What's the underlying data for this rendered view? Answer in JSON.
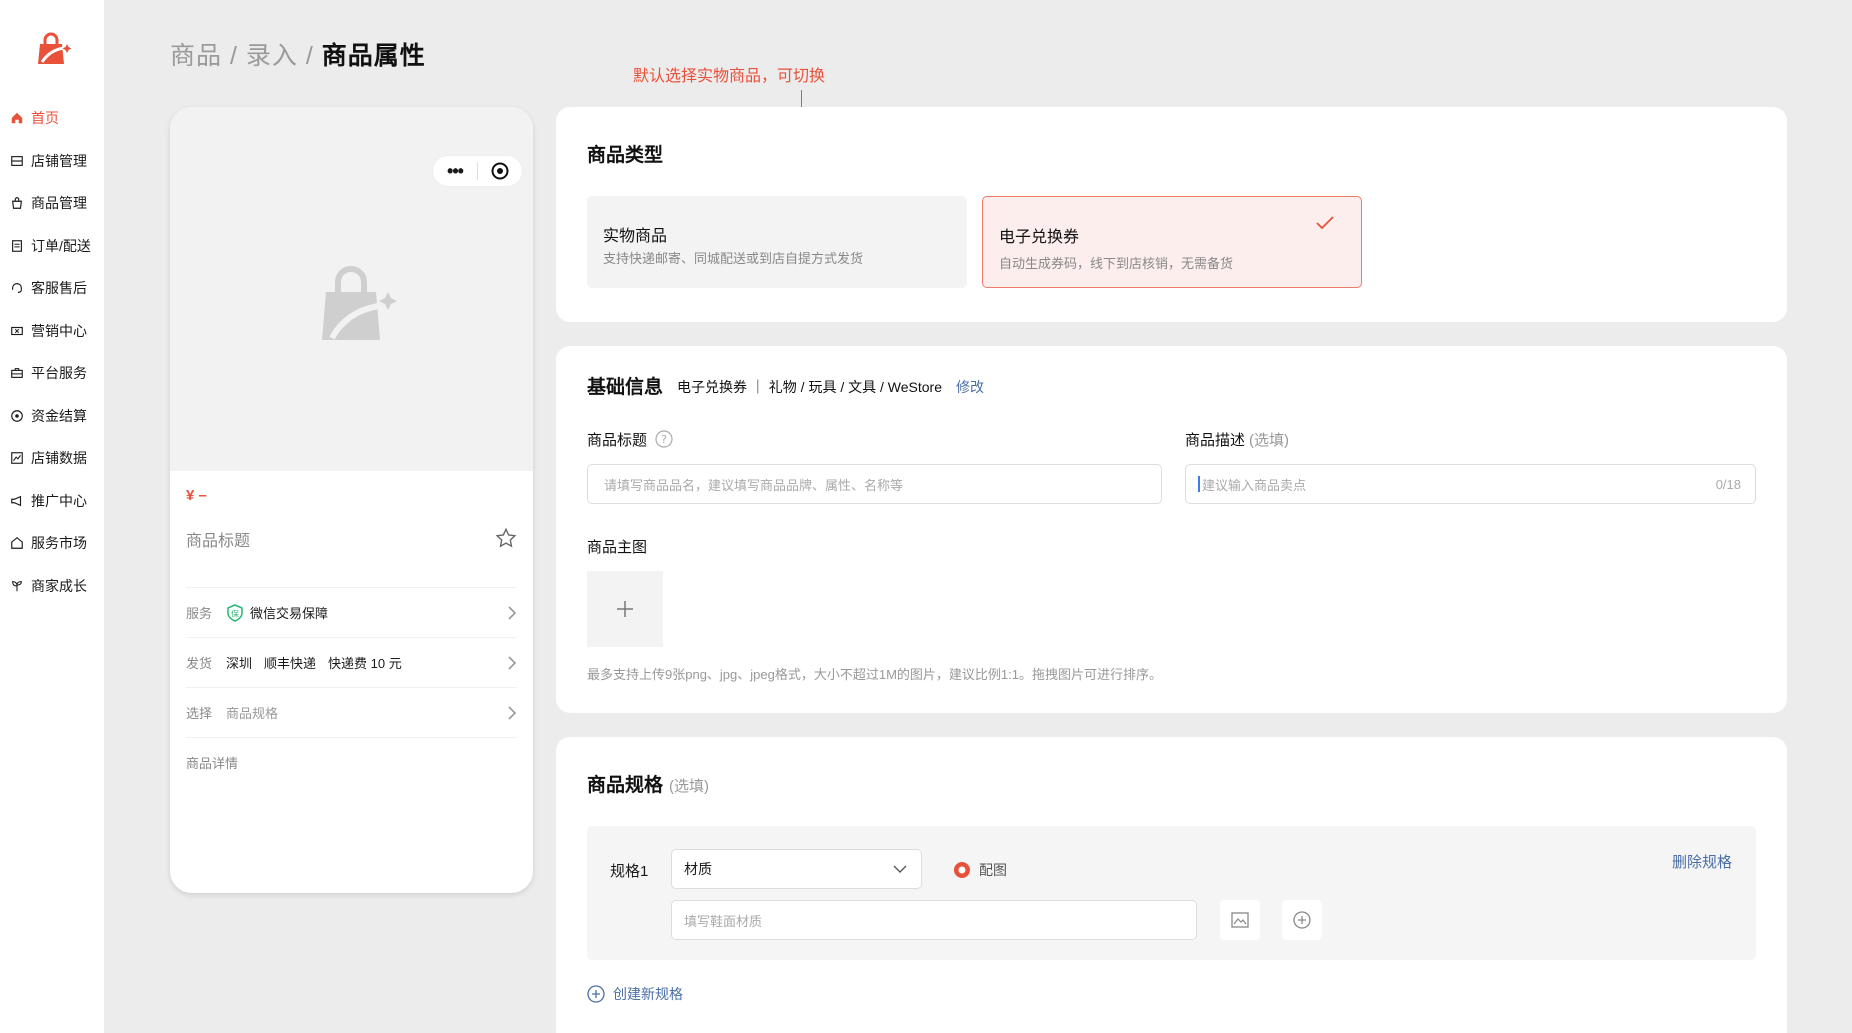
{
  "sidebar": {
    "items": [
      {
        "label": "首页",
        "icon": "home-icon",
        "active": true
      },
      {
        "label": "店铺管理",
        "icon": "store-icon"
      },
      {
        "label": "商品管理",
        "icon": "bag-icon"
      },
      {
        "label": "订单/配送",
        "icon": "order-icon"
      },
      {
        "label": "客服售后",
        "icon": "headset-icon"
      },
      {
        "label": "营销中心",
        "icon": "coupon-icon"
      },
      {
        "label": "平台服务",
        "icon": "briefcase-icon"
      },
      {
        "label": "资金结算",
        "icon": "coin-icon"
      },
      {
        "label": "店铺数据",
        "icon": "chart-icon"
      },
      {
        "label": "推广中心",
        "icon": "megaphone-icon"
      },
      {
        "label": "服务市场",
        "icon": "market-icon"
      },
      {
        "label": "商家成长",
        "icon": "sprout-icon"
      }
    ],
    "accent": "#e8513a"
  },
  "breadcrumb": {
    "a": "商品",
    "sep1": " / ",
    "b": "录入",
    "sep2": " / ",
    "current": "商品属性"
  },
  "annotation": "默认选择实物商品，可切换",
  "preview": {
    "price": "¥ –",
    "title": "商品标题",
    "rows": {
      "service_key": "服务",
      "service_val": "微信交易保障",
      "ship_key": "发货",
      "ship_city": "深圳",
      "ship_carrier": "顺丰快递",
      "ship_fee": "快递费 10 元",
      "spec_key": "选择",
      "spec_val": "商品规格",
      "detail": "商品详情"
    }
  },
  "type_card": {
    "heading": "商品类型",
    "options": [
      {
        "title": "实物商品",
        "desc": "支持快递邮寄、同城配送或到店自提方式发货",
        "selected": false
      },
      {
        "title": "电子兑换券",
        "desc": "自动生成券码，线下到店核销，无需备货",
        "selected": true
      }
    ]
  },
  "basic_card": {
    "heading": "基础信息",
    "category": "电子兑换券 ｜ 礼物 / 玩具 / 文具 / WeStore",
    "edit": "修改",
    "title_label": "商品标题",
    "title_placeholder": "请填写商品品名，建议填写商品品牌、属性、名称等",
    "desc_label": "商品描述",
    "desc_optional": "(选填)",
    "desc_placeholder": "建议输入商品卖点",
    "desc_count": "0/18",
    "image_label": "商品主图",
    "image_hint": "最多支持上传9张png、jpg、jpeg格式，大小不超过1M的图片，建议比例1:1。拖拽图片可进行排序。"
  },
  "spec_card": {
    "heading": "商品规格",
    "optional": "(选填)",
    "spec_label": "规格1",
    "spec_select": "材质",
    "radio_label": "配图",
    "delete": "删除规格",
    "value_placeholder": "填写鞋面材质",
    "create": "创建新规格"
  }
}
